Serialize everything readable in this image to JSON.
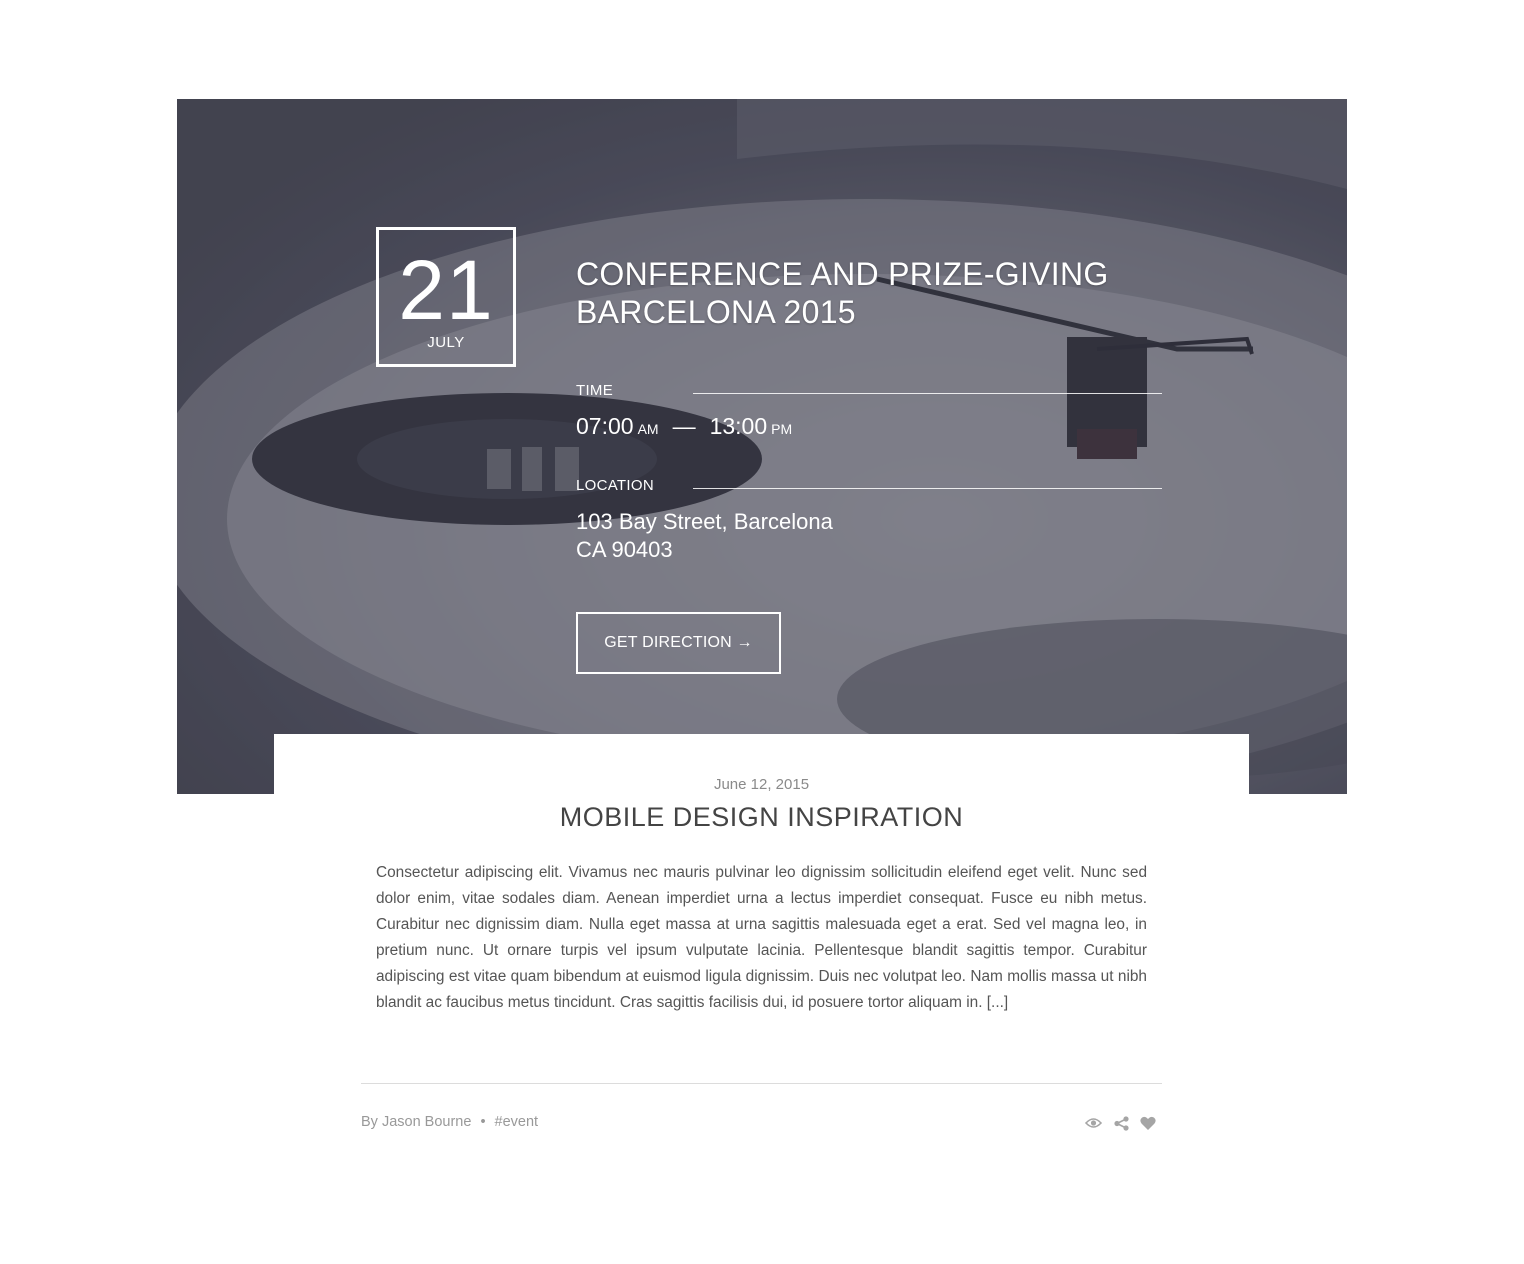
{
  "event": {
    "day": "21",
    "month": "JULY",
    "title_line1": "CONFERENCE AND PRIZE-GIVING",
    "title_line2": "BARCELONA 2015",
    "time_label": "TIME",
    "start_time": "07:00",
    "start_ampm": "AM",
    "time_separator": "—",
    "end_time": "13:00",
    "end_ampm": "PM",
    "location_label": "LOCATION",
    "address_line1": "103 Bay Street, Barcelona",
    "address_line2": "CA 90403",
    "cta_label": "GET DIRECTION →"
  },
  "post": {
    "date": "June 12, 2015",
    "title": "MOBILE DESIGN INSPIRATION",
    "excerpt": "Consectetur adipiscing elit. Vivamus nec mauris pulvinar leo dignissim sollicitudin eleifend eget velit. Nunc sed dolor enim, vitae sodales diam. Aenean imperdiet urna a lectus imperdiet consequat. Fusce eu nibh metus. Curabitur nec dignissim diam. Nulla eget massa at urna sagittis malesuada eget a erat. Sed vel magna leo, in pretium nunc. Ut ornare turpis vel ipsum vulputate lacinia. Pellentesque blandit sagittis tempor. Curabitur adipiscing est vitae quam bibendum at euismod ligula dignissim. Duis nec volutpat leo. Nam mollis massa ut nibh blandit ac faucibus metus tincidunt. Cras sagittis facilisis dui, id posuere tortor aliquam in. [...]",
    "author": "By Jason Bourne",
    "separator": "•",
    "tag": "#event"
  },
  "icons": [
    "eye-icon",
    "share-icon",
    "heart-icon"
  ],
  "colors": {
    "hero_overlay": "#4a4b5a",
    "text_light": "#ffffff",
    "title_dark": "#444444",
    "meta_gray": "#999999"
  }
}
